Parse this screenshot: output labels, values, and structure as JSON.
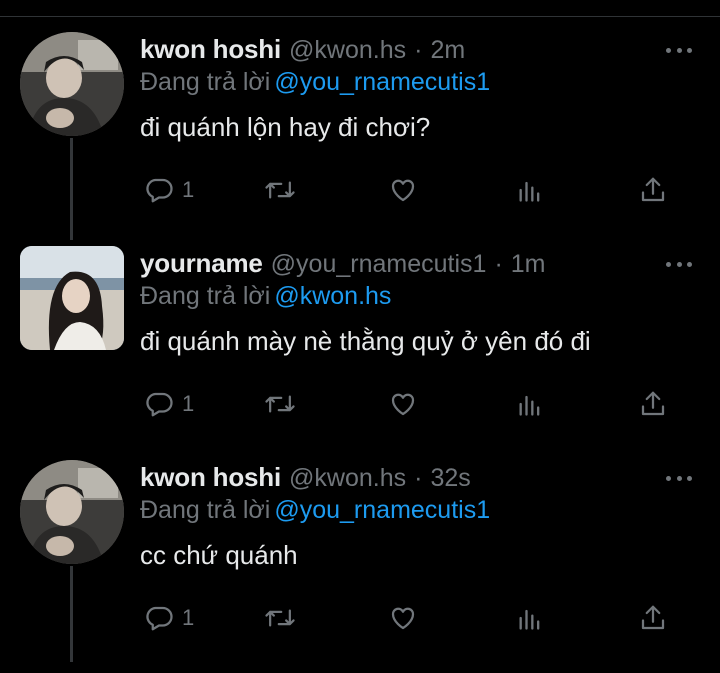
{
  "tweets": [
    {
      "author": "kwon hoshi",
      "handle": "@kwon.hs",
      "separator": "·",
      "time": "2m",
      "reply_prefix": "Đang trả lời",
      "reply_to": "@you_rnamecutis1",
      "text": "đi quánh lộn hay đi chơi?",
      "reply_count": "1"
    },
    {
      "author": "yourname",
      "handle": "@you_rnamecutis1",
      "separator": "·",
      "time": "1m",
      "reply_prefix": "Đang trả lời",
      "reply_to": "@kwon.hs",
      "text": "đi quánh mày nè thằng quỷ ở yên đó đi",
      "reply_count": "1"
    },
    {
      "author": "kwon hoshi",
      "handle": "@kwon.hs",
      "separator": "·",
      "time": "32s",
      "reply_prefix": "Đang trả lời",
      "reply_to": "@you_rnamecutis1",
      "text": "cc chứ quánh",
      "reply_count": "1"
    }
  ],
  "icons": {
    "reply": "reply-icon",
    "retweet": "retweet-icon",
    "like": "heart-icon",
    "views": "analytics-icon",
    "share": "share-icon",
    "more": "more-icon"
  },
  "colors": {
    "background": "#000000",
    "text": "#e7e9ea",
    "muted": "#71767b",
    "mention": "#1d9bf0"
  }
}
